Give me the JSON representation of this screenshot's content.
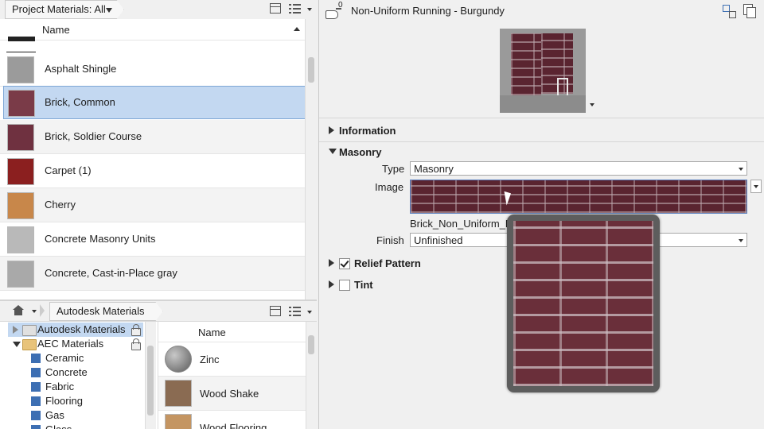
{
  "project_panel": {
    "filter_label": "Project Materials: All",
    "column_name": "Name",
    "materials": [
      {
        "name": "Asphalt Shingle",
        "swatch": "#9b9b9b"
      },
      {
        "name": "Brick, Common",
        "swatch": "#7a3b48",
        "selected": true
      },
      {
        "name": "Brick, Soldier Course",
        "swatch": "#6f3140"
      },
      {
        "name": "Carpet (1)",
        "swatch": "#8b1f1f"
      },
      {
        "name": "Cherry",
        "swatch": "#c8874a"
      },
      {
        "name": "Concrete Masonry Units",
        "swatch": "#b9b9b9"
      },
      {
        "name": "Concrete, Cast-in-Place gray",
        "swatch": "#a9a9a9"
      }
    ]
  },
  "library_panel": {
    "breadcrumb": "Autodesk Materials",
    "tree": [
      {
        "label": "Autodesk Materials",
        "type": "root"
      },
      {
        "label": "AEC Materials",
        "type": "folder"
      },
      {
        "label": "Ceramic",
        "type": "category"
      },
      {
        "label": "Concrete",
        "type": "category"
      },
      {
        "label": "Fabric",
        "type": "category"
      },
      {
        "label": "Flooring",
        "type": "category"
      },
      {
        "label": "Gas",
        "type": "category"
      },
      {
        "label": "Glass",
        "type": "category"
      }
    ],
    "column_name": "Name",
    "items": [
      {
        "name": "Zinc",
        "swatch": "#7d7d7d"
      },
      {
        "name": "Wood Shake",
        "swatch": "#8a6b52"
      },
      {
        "name": "Wood Flooring",
        "swatch": "#c49562"
      }
    ]
  },
  "editor": {
    "asset_count": "0",
    "title": "Non-Uniform Running - Burgundy",
    "sections": {
      "information": "Information",
      "masonry": "Masonry",
      "relief_pattern": "Relief Pattern",
      "tint": "Tint"
    },
    "fields": {
      "type_label": "Type",
      "type_value": "Masonry",
      "image_label": "Image",
      "image_filename": "Brick_Non_Uniform_Ru",
      "finish_label": "Finish",
      "finish_value": "Unfinished"
    },
    "relief_pattern_checked": true,
    "tint_checked": false
  }
}
